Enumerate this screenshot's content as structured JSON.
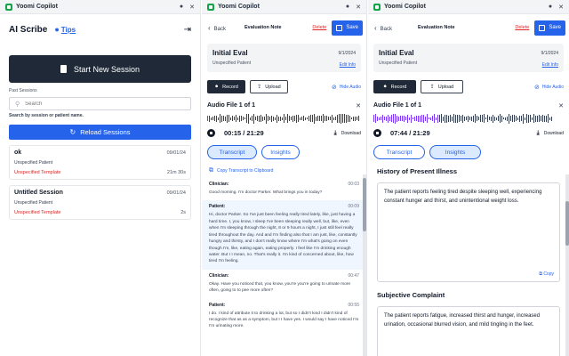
{
  "app": {
    "name": "Yoomi Copilot"
  },
  "home": {
    "title": "AI Scribe",
    "tips_label": "Tips",
    "start_label": "Start New Session",
    "past_label": "Past Sessions",
    "search_placeholder": "Search",
    "search_hint": "Search by session or patient name.",
    "reload_label": "Reload Sessions",
    "sessions": [
      {
        "name": "ok",
        "date": "09/01/24",
        "patient": "Unspecified Patient",
        "template": "Unspecified Template",
        "duration": "21m 30s"
      },
      {
        "name": "Untitled Session",
        "date": "09/01/24",
        "patient": "Unspecified Patient",
        "template": "Unspecified Template",
        "duration": "2s"
      }
    ]
  },
  "note": {
    "back_label": "Back",
    "header_title": "Evaluation Note",
    "delete_label": "Delete",
    "save_label": "Save",
    "title": "Initial Eval",
    "patient": "Unspecified Patient",
    "date": "9/1/2024",
    "edit_info_label": "Edit Info",
    "record_label": "Record",
    "upload_label": "Upload",
    "hide_audio_label": "Hide Audio",
    "audio_title": "Audio File 1 of 1",
    "download_label": "Download",
    "tab_transcript": "Transcript",
    "tab_insights": "Insights"
  },
  "transcript_view": {
    "time": "00:15 / 21:29",
    "copy_label": "Copy Transcript to Clipboard",
    "utterances": [
      {
        "speaker": "Clinician:",
        "ts": "00:03",
        "text": "Good morning. I'm doctor Parker. What brings you in today?"
      },
      {
        "speaker": "Patient:",
        "ts": "00:09",
        "text": "Hi, doctor Parker. So I've just been feeling really tired lately, like, just having a hard time. I, you know, I sleep I've been sleeping really well, but, like, even when I'm sleeping through the night, 8 or 9 hours a night, I just still feel really tired throughout the day. And and I'm finding also that I am just, like, constantly hungry and thirsty, and I don't really know where I'm what's going on even though I'm, like, eating again, eating properly. I feel like I'm drinking enough water. But I I mean, no. That's really it. I'm kind of concerned about, like, how tired I'm feeling."
      },
      {
        "speaker": "Clinician:",
        "ts": "00:47",
        "text": "Okay. Have you noticed that, you know, you're you're going to urinate more often, going to to pee more often?"
      },
      {
        "speaker": "Patient:",
        "ts": "00:55",
        "text": "I do. I kind of attribute it to drinking a lot, but so I didn't kind I didn't kind of recognize that as as a symptom, but I I have yes. I would say I have noticed I'm I'm urinating more."
      }
    ]
  },
  "insights_view": {
    "time": "07:44 / 21:29",
    "sections": [
      {
        "heading": "History of Present Illness",
        "text": "The patient reports feeling tired despite sleeping well, experiencing constant hunger and thirst, and unintentional weight loss.",
        "copy_label": "Copy"
      },
      {
        "heading": "Subjective Complaint",
        "text": "The patient reports fatigue, increased thirst and hunger, increased urination, occasional blurred vision, and mild tingling in the feet."
      }
    ]
  },
  "colors": {
    "accent": "#2563eb",
    "dark": "#1f2937",
    "danger": "#dc2626",
    "wave_played": "#7c3aed"
  }
}
